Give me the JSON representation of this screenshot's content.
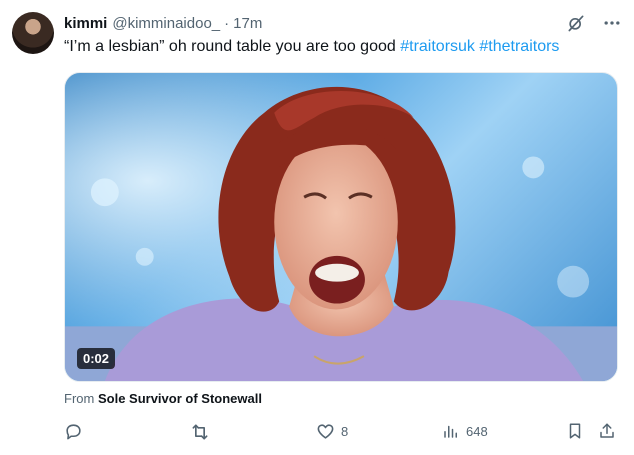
{
  "tweet": {
    "author_name": "kimmi",
    "handle": "@kimminaidoo_",
    "separator": "·",
    "time": "17m",
    "text_plain": "“I’m a lesbian” oh round table you are too good",
    "hashtags": [
      "#traitorsuk",
      "#thetraitors"
    ],
    "media": {
      "duration": "0:02"
    },
    "from": {
      "prefix": "From",
      "source": "Sole Survivor of Stonewall"
    }
  },
  "actions": {
    "reply_count": "",
    "retweet_count": "",
    "like_count": "8",
    "view_count": "648"
  },
  "icons": {
    "grok": "grok-icon",
    "more": "more-icon",
    "reply": "reply-icon",
    "retweet": "retweet-icon",
    "like": "heart-icon",
    "views": "views-icon",
    "bookmark": "bookmark-icon",
    "share": "share-icon"
  },
  "colors": {
    "link": "#1d9bf0",
    "secondary_text": "#536471",
    "primary_text": "#0f1419"
  }
}
